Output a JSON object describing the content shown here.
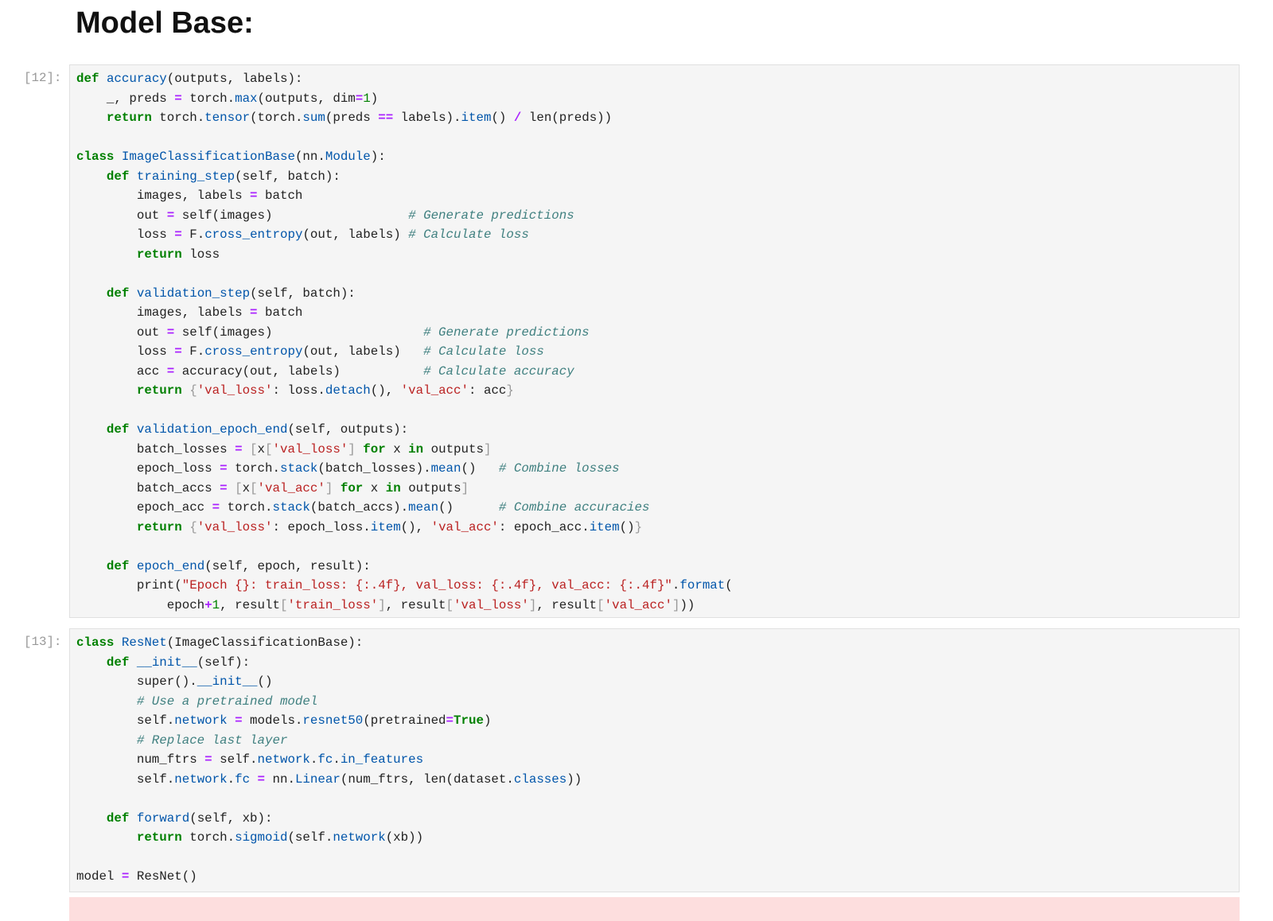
{
  "heading": "Model Base:",
  "colors": {
    "keyword": "#008000",
    "name": "#0055aa",
    "operator": "#aa22ff",
    "string": "#ba2121",
    "comment": "#408080",
    "bracket": "#999999",
    "cell_bg": "#f5f5f5",
    "error_bg": "#fddede"
  },
  "cells": [
    {
      "prompt": "[12]:",
      "lines": [
        [
          [
            "k",
            "def"
          ],
          [
            "p",
            " "
          ],
          [
            "f",
            "accuracy"
          ],
          [
            "p",
            "(outputs, labels):"
          ]
        ],
        [
          [
            "p",
            "    _, preds "
          ],
          [
            "o",
            "="
          ],
          [
            "p",
            " torch."
          ],
          [
            "f",
            "max"
          ],
          [
            "p",
            "(outputs, dim"
          ],
          [
            "o",
            "="
          ],
          [
            "n",
            "1"
          ],
          [
            "p",
            ")"
          ]
        ],
        [
          [
            "p",
            "    "
          ],
          [
            "k",
            "return"
          ],
          [
            "p",
            " torch."
          ],
          [
            "f",
            "tensor"
          ],
          [
            "p",
            "(torch."
          ],
          [
            "f",
            "sum"
          ],
          [
            "p",
            "(preds "
          ],
          [
            "o",
            "=="
          ],
          [
            "p",
            " labels)."
          ],
          [
            "f",
            "item"
          ],
          [
            "p",
            "() "
          ],
          [
            "o",
            "/"
          ],
          [
            "p",
            " len(preds))"
          ]
        ],
        [],
        [
          [
            "k",
            "class"
          ],
          [
            "p",
            " "
          ],
          [
            "f",
            "ImageClassificationBase"
          ],
          [
            "p",
            "(nn."
          ],
          [
            "f",
            "Module"
          ],
          [
            "p",
            "):"
          ]
        ],
        [
          [
            "p",
            "    "
          ],
          [
            "k",
            "def"
          ],
          [
            "p",
            " "
          ],
          [
            "f",
            "training_step"
          ],
          [
            "p",
            "(self, batch):"
          ]
        ],
        [
          [
            "p",
            "        images, labels "
          ],
          [
            "o",
            "="
          ],
          [
            "p",
            " batch"
          ]
        ],
        [
          [
            "p",
            "        out "
          ],
          [
            "o",
            "="
          ],
          [
            "p",
            " self(images)                  "
          ],
          [
            "c",
            "# Generate predictions"
          ]
        ],
        [
          [
            "p",
            "        loss "
          ],
          [
            "o",
            "="
          ],
          [
            "p",
            " F."
          ],
          [
            "f",
            "cross_entropy"
          ],
          [
            "p",
            "(out, labels) "
          ],
          [
            "c",
            "# Calculate loss"
          ]
        ],
        [
          [
            "p",
            "        "
          ],
          [
            "k",
            "return"
          ],
          [
            "p",
            " loss"
          ]
        ],
        [],
        [
          [
            "p",
            "    "
          ],
          [
            "k",
            "def"
          ],
          [
            "p",
            " "
          ],
          [
            "f",
            "validation_step"
          ],
          [
            "p",
            "(self, batch):"
          ]
        ],
        [
          [
            "p",
            "        images, labels "
          ],
          [
            "o",
            "="
          ],
          [
            "p",
            " batch"
          ]
        ],
        [
          [
            "p",
            "        out "
          ],
          [
            "o",
            "="
          ],
          [
            "p",
            " self(images)                    "
          ],
          [
            "c",
            "# Generate predictions"
          ]
        ],
        [
          [
            "p",
            "        loss "
          ],
          [
            "o",
            "="
          ],
          [
            "p",
            " F."
          ],
          [
            "f",
            "cross_entropy"
          ],
          [
            "p",
            "(out, labels)   "
          ],
          [
            "c",
            "# Calculate loss"
          ]
        ],
        [
          [
            "p",
            "        acc "
          ],
          [
            "o",
            "="
          ],
          [
            "p",
            " accuracy(out, labels)           "
          ],
          [
            "c",
            "# Calculate accuracy"
          ]
        ],
        [
          [
            "p",
            "        "
          ],
          [
            "k",
            "return"
          ],
          [
            "p",
            " "
          ],
          [
            "b",
            "{"
          ],
          [
            "s",
            "'val_loss'"
          ],
          [
            "p",
            ": loss."
          ],
          [
            "f",
            "detach"
          ],
          [
            "p",
            "(), "
          ],
          [
            "s",
            "'val_acc'"
          ],
          [
            "p",
            ": acc"
          ],
          [
            "b",
            "}"
          ]
        ],
        [],
        [
          [
            "p",
            "    "
          ],
          [
            "k",
            "def"
          ],
          [
            "p",
            " "
          ],
          [
            "f",
            "validation_epoch_end"
          ],
          [
            "p",
            "(self, outputs):"
          ]
        ],
        [
          [
            "p",
            "        batch_losses "
          ],
          [
            "o",
            "="
          ],
          [
            "p",
            " "
          ],
          [
            "b",
            "["
          ],
          [
            "p",
            "x"
          ],
          [
            "b",
            "["
          ],
          [
            "s",
            "'val_loss'"
          ],
          [
            "b",
            "]"
          ],
          [
            "p",
            " "
          ],
          [
            "k",
            "for"
          ],
          [
            "p",
            " x "
          ],
          [
            "k",
            "in"
          ],
          [
            "p",
            " outputs"
          ],
          [
            "b",
            "]"
          ]
        ],
        [
          [
            "p",
            "        epoch_loss "
          ],
          [
            "o",
            "="
          ],
          [
            "p",
            " torch."
          ],
          [
            "f",
            "stack"
          ],
          [
            "p",
            "(batch_losses)."
          ],
          [
            "f",
            "mean"
          ],
          [
            "p",
            "()   "
          ],
          [
            "c",
            "# Combine losses"
          ]
        ],
        [
          [
            "p",
            "        batch_accs "
          ],
          [
            "o",
            "="
          ],
          [
            "p",
            " "
          ],
          [
            "b",
            "["
          ],
          [
            "p",
            "x"
          ],
          [
            "b",
            "["
          ],
          [
            "s",
            "'val_acc'"
          ],
          [
            "b",
            "]"
          ],
          [
            "p",
            " "
          ],
          [
            "k",
            "for"
          ],
          [
            "p",
            " x "
          ],
          [
            "k",
            "in"
          ],
          [
            "p",
            " outputs"
          ],
          [
            "b",
            "]"
          ]
        ],
        [
          [
            "p",
            "        epoch_acc "
          ],
          [
            "o",
            "="
          ],
          [
            "p",
            " torch."
          ],
          [
            "f",
            "stack"
          ],
          [
            "p",
            "(batch_accs)."
          ],
          [
            "f",
            "mean"
          ],
          [
            "p",
            "()      "
          ],
          [
            "c",
            "# Combine accuracies"
          ]
        ],
        [
          [
            "p",
            "        "
          ],
          [
            "k",
            "return"
          ],
          [
            "p",
            " "
          ],
          [
            "b",
            "{"
          ],
          [
            "s",
            "'val_loss'"
          ],
          [
            "p",
            ": epoch_loss."
          ],
          [
            "f",
            "item"
          ],
          [
            "p",
            "(), "
          ],
          [
            "s",
            "'val_acc'"
          ],
          [
            "p",
            ": epoch_acc."
          ],
          [
            "f",
            "item"
          ],
          [
            "p",
            "()"
          ],
          [
            "b",
            "}"
          ]
        ],
        [],
        [
          [
            "p",
            "    "
          ],
          [
            "k",
            "def"
          ],
          [
            "p",
            " "
          ],
          [
            "f",
            "epoch_end"
          ],
          [
            "p",
            "(self, epoch, result):"
          ]
        ],
        [
          [
            "p",
            "        print("
          ],
          [
            "s",
            "\"Epoch {}: train_loss: {:.4f}, val_loss: {:.4f}, val_acc: {:.4f}\""
          ],
          [
            "p",
            "."
          ],
          [
            "f",
            "format"
          ],
          [
            "p",
            "("
          ]
        ],
        [
          [
            "p",
            "            epoch"
          ],
          [
            "o",
            "+"
          ],
          [
            "n",
            "1"
          ],
          [
            "p",
            ", result"
          ],
          [
            "b",
            "["
          ],
          [
            "s",
            "'train_loss'"
          ],
          [
            "b",
            "]"
          ],
          [
            "p",
            ", result"
          ],
          [
            "b",
            "["
          ],
          [
            "s",
            "'val_loss'"
          ],
          [
            "b",
            "]"
          ],
          [
            "p",
            ", result"
          ],
          [
            "b",
            "["
          ],
          [
            "s",
            "'val_acc'"
          ],
          [
            "b",
            "]"
          ],
          [
            "p",
            "))"
          ]
        ]
      ]
    },
    {
      "prompt": "[13]:",
      "lines": [
        [
          [
            "k",
            "class"
          ],
          [
            "p",
            " "
          ],
          [
            "f",
            "ResNet"
          ],
          [
            "p",
            "(ImageClassificationBase):"
          ]
        ],
        [
          [
            "p",
            "    "
          ],
          [
            "k",
            "def"
          ],
          [
            "p",
            " "
          ],
          [
            "f",
            "__init__"
          ],
          [
            "p",
            "(self):"
          ]
        ],
        [
          [
            "p",
            "        super()."
          ],
          [
            "f",
            "__init__"
          ],
          [
            "p",
            "()"
          ]
        ],
        [
          [
            "p",
            "        "
          ],
          [
            "c",
            "# Use a pretrained model"
          ]
        ],
        [
          [
            "p",
            "        self."
          ],
          [
            "f",
            "network"
          ],
          [
            "p",
            " "
          ],
          [
            "o",
            "="
          ],
          [
            "p",
            " models."
          ],
          [
            "f",
            "resnet50"
          ],
          [
            "p",
            "(pretrained"
          ],
          [
            "o",
            "="
          ],
          [
            "k",
            "True"
          ],
          [
            "p",
            ")"
          ]
        ],
        [
          [
            "p",
            "        "
          ],
          [
            "c",
            "# Replace last layer"
          ]
        ],
        [
          [
            "p",
            "        num_ftrs "
          ],
          [
            "o",
            "="
          ],
          [
            "p",
            " self."
          ],
          [
            "f",
            "network"
          ],
          [
            "p",
            "."
          ],
          [
            "f",
            "fc"
          ],
          [
            "p",
            "."
          ],
          [
            "f",
            "in_features"
          ]
        ],
        [
          [
            "p",
            "        self."
          ],
          [
            "f",
            "network"
          ],
          [
            "p",
            "."
          ],
          [
            "f",
            "fc"
          ],
          [
            "p",
            " "
          ],
          [
            "o",
            "="
          ],
          [
            "p",
            " nn."
          ],
          [
            "f",
            "Linear"
          ],
          [
            "p",
            "(num_ftrs, len(dataset."
          ],
          [
            "f",
            "classes"
          ],
          [
            "p",
            "))"
          ]
        ],
        [],
        [
          [
            "p",
            "    "
          ],
          [
            "k",
            "def"
          ],
          [
            "p",
            " "
          ],
          [
            "f",
            "forward"
          ],
          [
            "p",
            "(self, xb):"
          ]
        ],
        [
          [
            "p",
            "        "
          ],
          [
            "k",
            "return"
          ],
          [
            "p",
            " torch."
          ],
          [
            "f",
            "sigmoid"
          ],
          [
            "p",
            "(self."
          ],
          [
            "f",
            "network"
          ],
          [
            "p",
            "(xb))"
          ]
        ],
        [],
        [
          [
            "p",
            "model "
          ],
          [
            "o",
            "="
          ],
          [
            "p",
            " ResNet()"
          ]
        ]
      ]
    }
  ]
}
